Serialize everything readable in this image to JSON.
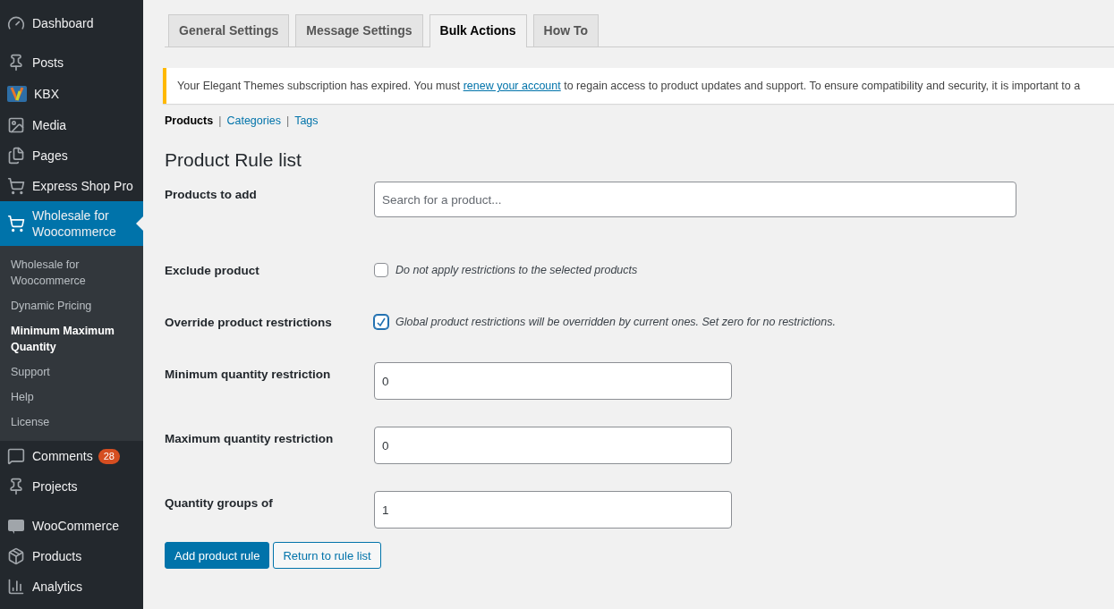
{
  "sidebar": {
    "groups": [
      [
        {
          "label": "Dashboard",
          "selected": false
        }
      ],
      [
        {
          "label": "Posts",
          "selected": false
        },
        {
          "label": "KBX",
          "selected": false
        },
        {
          "label": "Media",
          "selected": false
        },
        {
          "label": "Pages",
          "selected": false
        },
        {
          "label": "Express Shop Pro",
          "selected": false
        },
        {
          "label": "Wholesale for Woocommerce",
          "selected": true,
          "children": [
            {
              "label": "Wholesale for Woocommerce",
              "selected": false
            },
            {
              "label": "Dynamic Pricing",
              "selected": false
            },
            {
              "label": "Minimum Maximum Quantity",
              "selected": true
            },
            {
              "label": "Support",
              "selected": false
            },
            {
              "label": "Help",
              "selected": false
            },
            {
              "label": "License",
              "selected": false
            }
          ]
        },
        {
          "label": "Comments",
          "selected": false,
          "badge": "28"
        },
        {
          "label": "Projects",
          "selected": false
        }
      ],
      [
        {
          "label": "WooCommerce",
          "selected": false
        },
        {
          "label": "Products",
          "selected": false
        },
        {
          "label": "Analytics",
          "selected": false
        }
      ]
    ]
  },
  "tabs": [
    {
      "label": "General Settings",
      "selected": false
    },
    {
      "label": "Message Settings",
      "selected": false
    },
    {
      "label": "Bulk Actions",
      "selected": true
    },
    {
      "label": "How To",
      "selected": false
    }
  ],
  "notice": {
    "before": "Your Elegant Themes subscription has expired. You must ",
    "link": "renew your account",
    "after": " to regain access to product updates and support. To ensure compatibility and security, it is important to a"
  },
  "subnav": [
    {
      "label": "Products",
      "selected": true
    },
    {
      "separator": "|",
      "label": "Categories",
      "selected": false
    },
    {
      "separator": "|",
      "label": "Tags",
      "selected": false
    }
  ],
  "heading": "Product Rule list",
  "form": [
    {
      "kind": "search",
      "label": "Products to add",
      "placeholder": "Search for a product..."
    },
    {
      "kind": "checkbox",
      "label": "Exclude product",
      "checked": false,
      "description": "Do not apply restrictions to the selected products"
    },
    {
      "kind": "checkbox",
      "label": "Override product restrictions",
      "checked": true,
      "description": "Global product restrictions will be overridden by current ones. Set zero for no restrictions."
    },
    {
      "kind": "number",
      "label": "Minimum quantity restriction",
      "value": "0"
    },
    {
      "kind": "number",
      "label": "Maximum quantity restriction",
      "value": "0"
    },
    {
      "kind": "number",
      "label": "Quantity groups of",
      "value": "1"
    }
  ],
  "buttons": [
    {
      "label": "Add product rule",
      "kind": "primary"
    },
    {
      "label": "Return to rule list",
      "kind": "secondary"
    }
  ]
}
